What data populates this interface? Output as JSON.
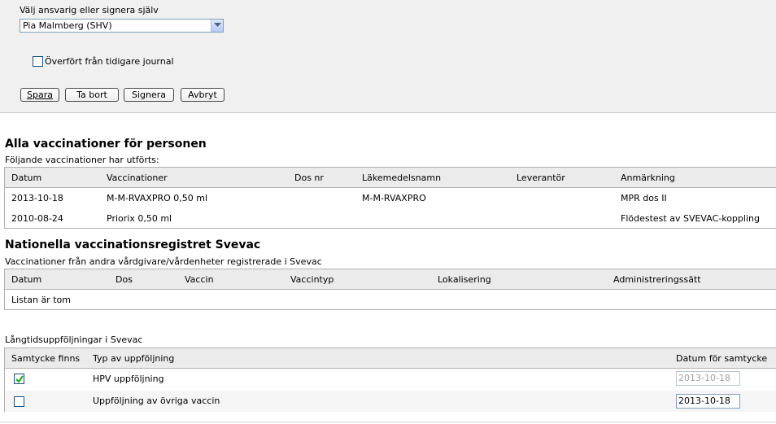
{
  "form": {
    "responsible_label": "Välj ansvarig eller signera själv",
    "responsible_value": "Pia Malmberg (SHV)",
    "transferred_label": "Överfört från tidigare journal",
    "transferred_checked": false,
    "buttons": {
      "save": "Spara",
      "delete": "Ta bort",
      "sign": "Signera",
      "cancel": "Avbryt"
    }
  },
  "vaccinations": {
    "title": "Alla vaccinationer för personen",
    "subtitle": "Följande vaccinationer har utförts:",
    "columns": [
      "Datum",
      "Vaccinationer",
      "Dos nr",
      "Läkemedelsnamn",
      "Leverantör",
      "Anmärkning"
    ],
    "rows": [
      {
        "datum": "2013-10-18",
        "vaccination": "M-M-RVAXPRO 0,50 ml",
        "dos": "",
        "lakemedel": "M-M-RVAXPRO",
        "leverantor": "",
        "anmarkning": "MPR dos II"
      },
      {
        "datum": "2010-08-24",
        "vaccination": "Priorix 0,50 ml",
        "dos": "",
        "lakemedel": "",
        "leverantor": "",
        "anmarkning": "Flödestest av SVEVAC-koppling"
      }
    ]
  },
  "svevac": {
    "title": "Nationella vaccinationsregistret Svevac",
    "subtitle": "Vaccinationer från andra vårdgivare/vårdenheter registrerade i Svevac",
    "columns": [
      "Datum",
      "Dos",
      "Vaccin",
      "Vaccintyp",
      "Lokalisering",
      "Administreringssätt"
    ],
    "empty_text": "Listan är tom"
  },
  "followups": {
    "title": "Långtidsuppföljningar i Svevac",
    "columns": [
      "Samtycke finns",
      "Typ av uppföljning",
      "Datum för samtycke"
    ],
    "rows": [
      {
        "consent": true,
        "type": "HPV uppföljning",
        "date": "2013-10-18",
        "date_disabled": true
      },
      {
        "consent": false,
        "type": "Uppföljning av övriga vaccin",
        "date": "2013-10-18",
        "date_disabled": false
      }
    ]
  },
  "colors": {
    "panel_bg": "#f0f0f0",
    "header_bg": "#ebebeb",
    "border": "#b0b0b0",
    "checkmark": "#21a121"
  }
}
